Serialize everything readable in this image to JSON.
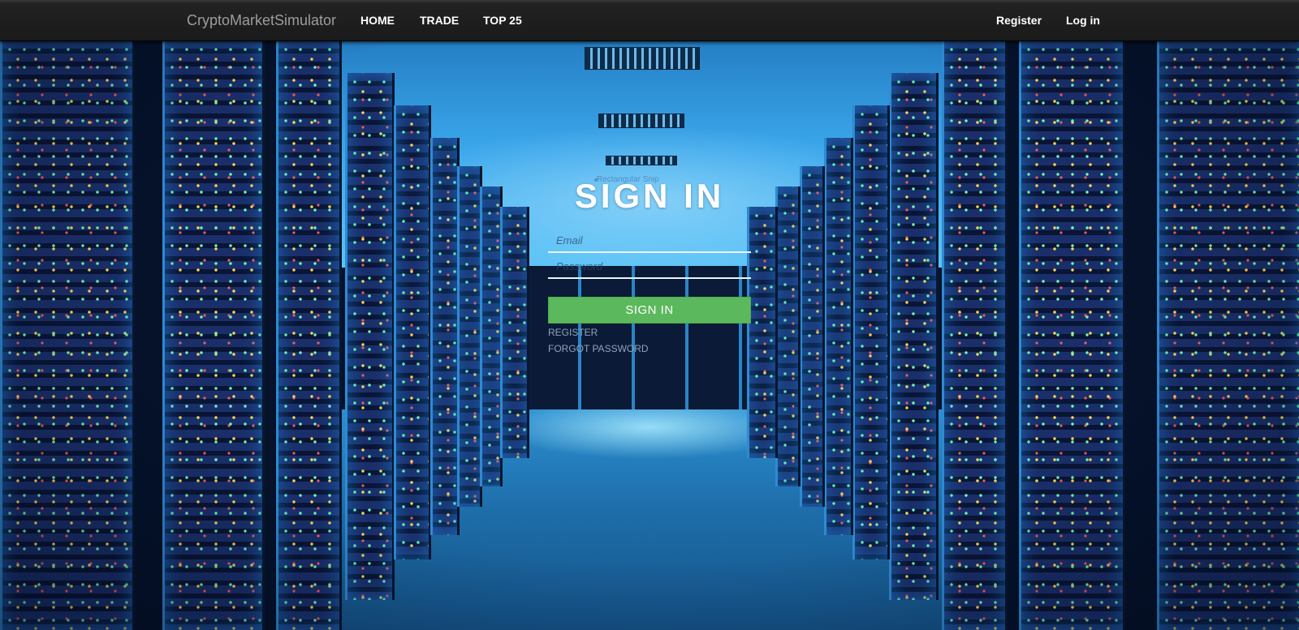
{
  "navbar": {
    "brand": "CryptoMarketSimulator",
    "links": [
      "HOME",
      "TRADE",
      "TOP 25"
    ],
    "register": "Register",
    "login": "Log in"
  },
  "form": {
    "title": "SIGN IN",
    "email_placeholder": "Email",
    "password_placeholder": "Password",
    "submit_label": "SIGN IN",
    "register_link": "REGISTER",
    "forgot_link": "FORGOT PASSWORD"
  },
  "ghost_text": "Rectangular Snip",
  "colors": {
    "navbar_bg": "#1a1a1a",
    "brand_text": "#9d9d9d",
    "button_green": "#5cb85c",
    "sublink": "#8fa4ba"
  }
}
